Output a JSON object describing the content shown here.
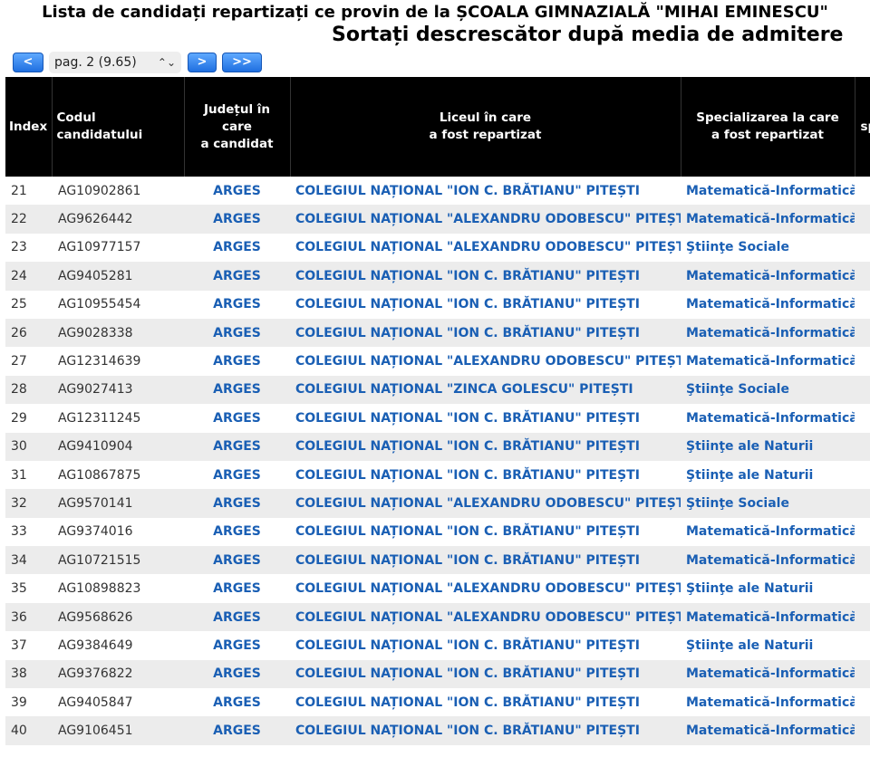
{
  "header": {
    "title": "Lista de candidați repartizați ce provin de la ȘCOALA GIMNAZIALĂ \"MIHAI EMINESCU\"",
    "subtitle": "Sortați descrescător după media de admitere"
  },
  "pager": {
    "prev_label": "<",
    "page_value": "pag. 2 (9.65)",
    "select_icon": "up-down-chevron-icon",
    "next_label": ">",
    "last_label": ">>",
    "button_color": "#2f7fe6"
  },
  "table": {
    "columns": [
      "Index",
      "Codul candidatului",
      "Județul în care\na candidat",
      "Liceul în care\na fost repartizat",
      "Specializarea la care\na fost repartizat",
      "sp"
    ],
    "link_color": "#1a5fb4",
    "rows": [
      {
        "index": "21",
        "cod": "AG10902861",
        "judet": "ARGES",
        "liceu": "COLEGIUL NAȚIONAL \"ION C. BRĂTIANU\" PITEȘTI",
        "spec": "Matematică-Informatică"
      },
      {
        "index": "22",
        "cod": "AG9626442",
        "judet": "ARGES",
        "liceu": "COLEGIUL NAȚIONAL \"ALEXANDRU ODOBESCU\" PITEȘTI",
        "spec": "Matematică-Informatică"
      },
      {
        "index": "23",
        "cod": "AG10977157",
        "judet": "ARGES",
        "liceu": "COLEGIUL NAȚIONAL \"ALEXANDRU ODOBESCU\" PITEȘTI",
        "spec": "Ştiinţe Sociale"
      },
      {
        "index": "24",
        "cod": "AG9405281",
        "judet": "ARGES",
        "liceu": "COLEGIUL NAȚIONAL \"ION C. BRĂTIANU\" PITEȘTI",
        "spec": "Matematică-Informatică"
      },
      {
        "index": "25",
        "cod": "AG10955454",
        "judet": "ARGES",
        "liceu": "COLEGIUL NAȚIONAL \"ION C. BRĂTIANU\" PITEȘTI",
        "spec": "Matematică-Informatică"
      },
      {
        "index": "26",
        "cod": "AG9028338",
        "judet": "ARGES",
        "liceu": "COLEGIUL NAȚIONAL \"ION C. BRĂTIANU\" PITEȘTI",
        "spec": "Matematică-Informatică"
      },
      {
        "index": "27",
        "cod": "AG12314639",
        "judet": "ARGES",
        "liceu": "COLEGIUL NAȚIONAL \"ALEXANDRU ODOBESCU\" PITEȘTI",
        "spec": "Matematică-Informatică"
      },
      {
        "index": "28",
        "cod": "AG9027413",
        "judet": "ARGES",
        "liceu": "COLEGIUL NAȚIONAL \"ZINCA GOLESCU\" PITEȘTI",
        "spec": "Ştiinţe Sociale"
      },
      {
        "index": "29",
        "cod": "AG12311245",
        "judet": "ARGES",
        "liceu": "COLEGIUL NAȚIONAL \"ION C. BRĂTIANU\" PITEȘTI",
        "spec": "Matematică-Informatică"
      },
      {
        "index": "30",
        "cod": "AG9410904",
        "judet": "ARGES",
        "liceu": "COLEGIUL NAȚIONAL \"ION C. BRĂTIANU\" PITEȘTI",
        "spec": "Ştiinţe ale Naturii"
      },
      {
        "index": "31",
        "cod": "AG10867875",
        "judet": "ARGES",
        "liceu": "COLEGIUL NAȚIONAL \"ION C. BRĂTIANU\" PITEȘTI",
        "spec": "Ştiinţe ale Naturii"
      },
      {
        "index": "32",
        "cod": "AG9570141",
        "judet": "ARGES",
        "liceu": "COLEGIUL NAȚIONAL \"ALEXANDRU ODOBESCU\" PITEȘTI",
        "spec": "Ştiinţe Sociale"
      },
      {
        "index": "33",
        "cod": "AG9374016",
        "judet": "ARGES",
        "liceu": "COLEGIUL NAȚIONAL \"ION C. BRĂTIANU\" PITEȘTI",
        "spec": "Matematică-Informatică"
      },
      {
        "index": "34",
        "cod": "AG10721515",
        "judet": "ARGES",
        "liceu": "COLEGIUL NAȚIONAL \"ION C. BRĂTIANU\" PITEȘTI",
        "spec": "Matematică-Informatică"
      },
      {
        "index": "35",
        "cod": "AG10898823",
        "judet": "ARGES",
        "liceu": "COLEGIUL NAȚIONAL \"ALEXANDRU ODOBESCU\" PITEȘTI",
        "spec": "Ştiinţe ale Naturii"
      },
      {
        "index": "36",
        "cod": "AG9568626",
        "judet": "ARGES",
        "liceu": "COLEGIUL NAȚIONAL \"ALEXANDRU ODOBESCU\" PITEȘTI",
        "spec": "Matematică-Informatică"
      },
      {
        "index": "37",
        "cod": "AG9384649",
        "judet": "ARGES",
        "liceu": "COLEGIUL NAȚIONAL \"ION C. BRĂTIANU\" PITEȘTI",
        "spec": "Ştiinţe ale Naturii"
      },
      {
        "index": "38",
        "cod": "AG9376822",
        "judet": "ARGES",
        "liceu": "COLEGIUL NAȚIONAL \"ION C. BRĂTIANU\" PITEȘTI",
        "spec": "Matematică-Informatică"
      },
      {
        "index": "39",
        "cod": "AG9405847",
        "judet": "ARGES",
        "liceu": "COLEGIUL NAȚIONAL \"ION C. BRĂTIANU\" PITEȘTI",
        "spec": "Matematică-Informatică"
      },
      {
        "index": "40",
        "cod": "AG9106451",
        "judet": "ARGES",
        "liceu": "COLEGIUL NAȚIONAL \"ION C. BRĂTIANU\" PITEȘTI",
        "spec": "Matematică-Informatică"
      }
    ]
  }
}
